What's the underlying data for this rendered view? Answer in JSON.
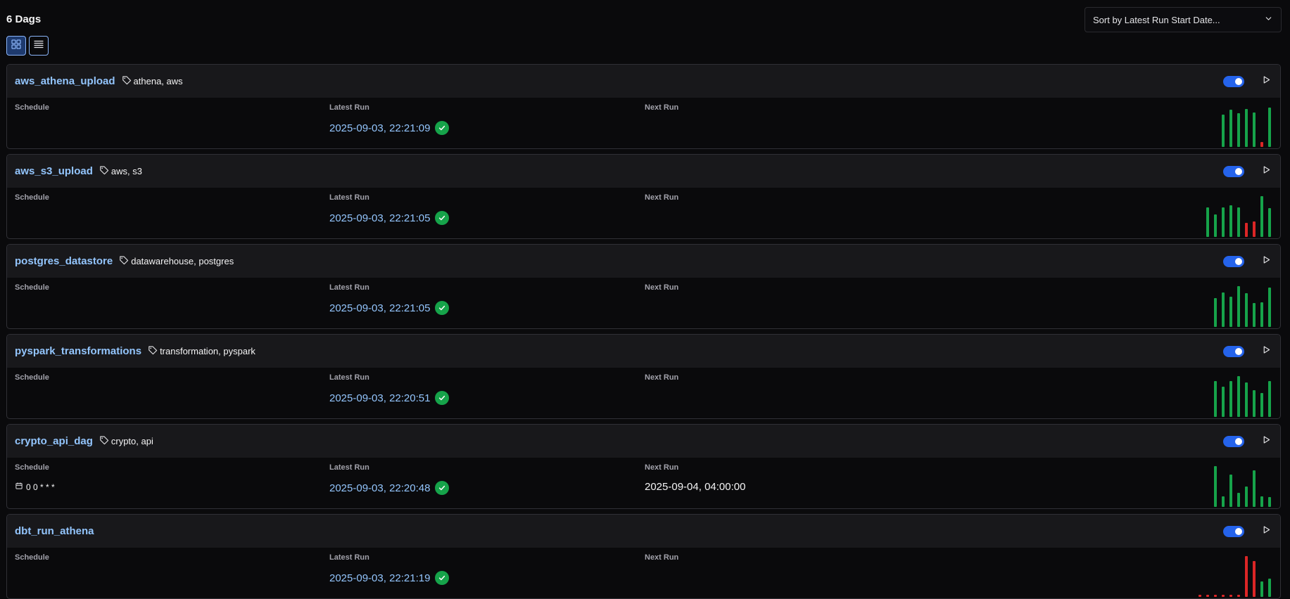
{
  "header": {
    "count_label": "6 Dags",
    "sort_label": "Sort by Latest Run Start Date..."
  },
  "column_labels": {
    "schedule": "Schedule",
    "latest_run": "Latest Run",
    "next_run": "Next Run"
  },
  "colors": {
    "success": "#16a34a",
    "failed": "#dc2626",
    "accent": "#2563eb",
    "link": "#93c5fd"
  },
  "dags": [
    {
      "name": "aws_athena_upload",
      "tags": "athena, aws",
      "schedule": "",
      "latest_run": "2025-09-03, 22:21:09",
      "latest_state": "success",
      "next_run": "",
      "runs": [
        {
          "d": 0.8,
          "s": "success"
        },
        {
          "d": 0.92,
          "s": "success"
        },
        {
          "d": 0.82,
          "s": "success"
        },
        {
          "d": 0.93,
          "s": "success"
        },
        {
          "d": 0.85,
          "s": "success"
        },
        {
          "d": 0.12,
          "s": "failed"
        },
        {
          "d": 0.97,
          "s": "success"
        }
      ]
    },
    {
      "name": "aws_s3_upload",
      "tags": "aws, s3",
      "schedule": "",
      "latest_run": "2025-09-03, 22:21:05",
      "latest_state": "success",
      "next_run": "",
      "runs": [
        {
          "d": 0.72,
          "s": "success"
        },
        {
          "d": 0.55,
          "s": "success"
        },
        {
          "d": 0.72,
          "s": "success"
        },
        {
          "d": 0.78,
          "s": "success"
        },
        {
          "d": 0.72,
          "s": "success"
        },
        {
          "d": 0.35,
          "s": "failed"
        },
        {
          "d": 0.38,
          "s": "failed"
        },
        {
          "d": 1.0,
          "s": "success"
        },
        {
          "d": 0.7,
          "s": "success"
        }
      ]
    },
    {
      "name": "postgres_datastore",
      "tags": "datawarehouse, postgres",
      "schedule": "",
      "latest_run": "2025-09-03, 22:21:05",
      "latest_state": "success",
      "next_run": "",
      "runs": [
        {
          "d": 0.7,
          "s": "success"
        },
        {
          "d": 0.85,
          "s": "success"
        },
        {
          "d": 0.74,
          "s": "success"
        },
        {
          "d": 1.0,
          "s": "success"
        },
        {
          "d": 0.82,
          "s": "success"
        },
        {
          "d": 0.58,
          "s": "success"
        },
        {
          "d": 0.6,
          "s": "success"
        },
        {
          "d": 0.96,
          "s": "success"
        }
      ]
    },
    {
      "name": "pyspark_transformations",
      "tags": "transformation, pyspark",
      "schedule": "",
      "latest_run": "2025-09-03, 22:20:51",
      "latest_state": "success",
      "next_run": "",
      "runs": [
        {
          "d": 0.88,
          "s": "success"
        },
        {
          "d": 0.74,
          "s": "success"
        },
        {
          "d": 0.88,
          "s": "success"
        },
        {
          "d": 1.0,
          "s": "success"
        },
        {
          "d": 0.85,
          "s": "success"
        },
        {
          "d": 0.66,
          "s": "success"
        },
        {
          "d": 0.58,
          "s": "success"
        },
        {
          "d": 0.88,
          "s": "success"
        }
      ]
    },
    {
      "name": "crypto_api_dag",
      "tags": "crypto, api",
      "schedule": "0 0 * * *",
      "latest_run": "2025-09-03, 22:20:48",
      "latest_state": "success",
      "next_run": "2025-09-04, 04:00:00",
      "runs": [
        {
          "d": 1.0,
          "s": "success"
        },
        {
          "d": 0.26,
          "s": "success"
        },
        {
          "d": 0.79,
          "s": "success"
        },
        {
          "d": 0.34,
          "s": "success"
        },
        {
          "d": 0.5,
          "s": "success"
        },
        {
          "d": 0.9,
          "s": "success"
        },
        {
          "d": 0.25,
          "s": "success"
        },
        {
          "d": 0.24,
          "s": "success"
        }
      ]
    },
    {
      "name": "dbt_run_athena",
      "tags": "",
      "schedule": "",
      "latest_run": "2025-09-03, 22:21:19",
      "latest_state": "success",
      "next_run": "",
      "runs": [
        {
          "d": 0.02,
          "s": "failed"
        },
        {
          "d": 0.02,
          "s": "failed"
        },
        {
          "d": 0.02,
          "s": "failed"
        },
        {
          "d": 0.02,
          "s": "failed"
        },
        {
          "d": 0.02,
          "s": "failed"
        },
        {
          "d": 0.02,
          "s": "failed"
        },
        {
          "d": 1.0,
          "s": "failed"
        },
        {
          "d": 0.88,
          "s": "failed"
        },
        {
          "d": 0.38,
          "s": "success"
        },
        {
          "d": 0.45,
          "s": "success"
        }
      ]
    }
  ]
}
